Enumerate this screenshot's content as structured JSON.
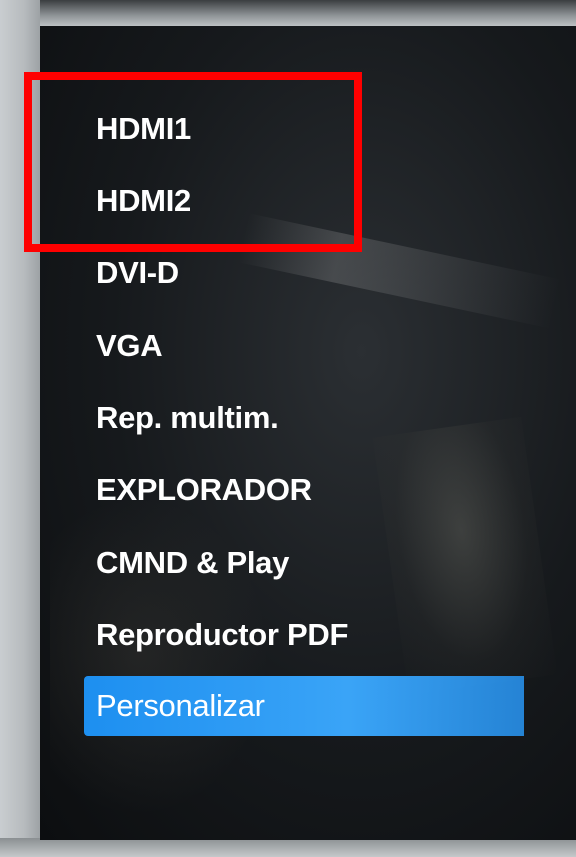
{
  "menu": {
    "items": [
      {
        "label": "HDMI1"
      },
      {
        "label": "HDMI2"
      },
      {
        "label": "DVI-D"
      },
      {
        "label": "VGA"
      },
      {
        "label": "Rep. multim."
      },
      {
        "label": "EXPLORADOR"
      },
      {
        "label": "CMND & Play"
      },
      {
        "label": "Reproductor PDF"
      },
      {
        "label": "Personalizar"
      }
    ],
    "selected_index": 8
  },
  "annotation": {
    "highlight_color": "#ff0000",
    "highlighted_items": [
      "HDMI1",
      "HDMI2"
    ]
  },
  "colors": {
    "selection": "#1d8ff0",
    "text": "#ffffff",
    "screen_bg": "#16191c"
  }
}
